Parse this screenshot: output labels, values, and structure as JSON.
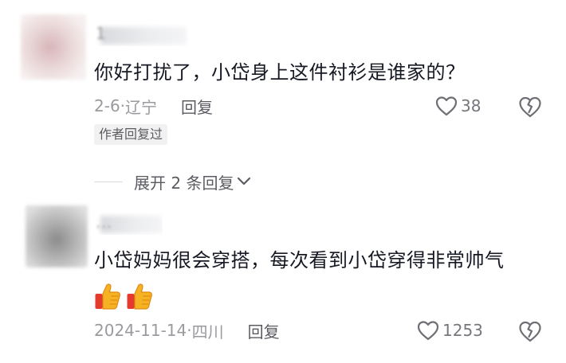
{
  "comments": [
    {
      "username": "1",
      "text": "你好打扰了，小岱身上这件衬衫是谁家的？",
      "date": "2-6",
      "separator": "·",
      "location": "辽宁",
      "reply_label": "回复",
      "likes": "38",
      "author_tag": "作者回复过"
    },
    {
      "username": "…",
      "text": "小岱妈妈很会穿搭，每次看到小岱穿得非常帅气",
      "emojis": [
        "thumbs-up",
        "thumbs-up"
      ],
      "date": "2024-11-14",
      "separator": "·",
      "location": "四川",
      "reply_label": "回复",
      "likes": "1253"
    }
  ],
  "expand_replies": "展开 2 条回复",
  "colors": {
    "text": "#161823",
    "meta": "#9a9a9f",
    "secondary": "#5b5b62",
    "thumb": "#f5b324"
  }
}
